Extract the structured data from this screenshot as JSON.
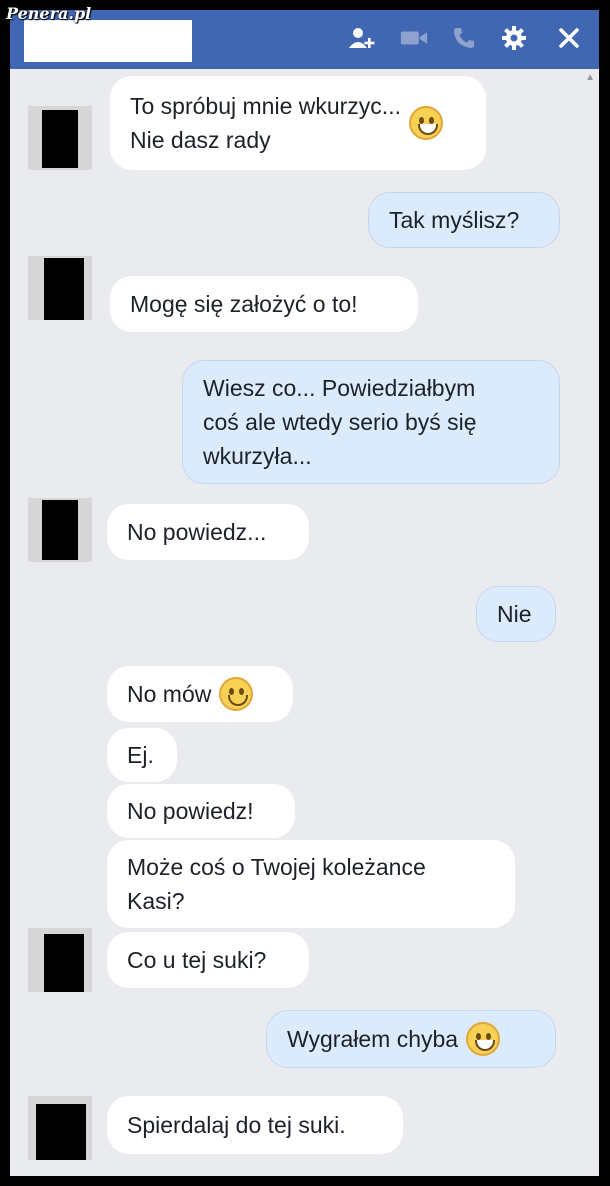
{
  "watermark": "Penera.pl",
  "header": {
    "icons": [
      "add-person-icon",
      "video-call-icon",
      "phone-icon",
      "gear-icon",
      "close-icon"
    ],
    "color": "#4267b2"
  },
  "messages": [
    {
      "side": "in",
      "text": "To spróbuj mnie wkurzyc...\nNie dasz rady",
      "emoji": "grin"
    },
    {
      "side": "out",
      "text": "Tak myślisz?"
    },
    {
      "side": "in",
      "text": "Mogę się założyć o to!"
    },
    {
      "side": "out",
      "text": "Wiesz co... Powiedziałbym\ncoś ale wtedy serio byś się\nwkurzyła..."
    },
    {
      "side": "in",
      "text": "No powiedz..."
    },
    {
      "side": "out",
      "text": "Nie"
    },
    {
      "side": "in",
      "text": "No mów",
      "emoji": "smile"
    },
    {
      "side": "in",
      "text": "Ej."
    },
    {
      "side": "in",
      "text": "No powiedz!"
    },
    {
      "side": "in",
      "text": "Może coś o Twojej koleżance\nKasi?"
    },
    {
      "side": "in",
      "text": "Co u tej suki?"
    },
    {
      "side": "out",
      "text": "Wygrałem chyba",
      "emoji": "grin"
    },
    {
      "side": "in",
      "text": "Spierdalaj do tej suki."
    }
  ]
}
